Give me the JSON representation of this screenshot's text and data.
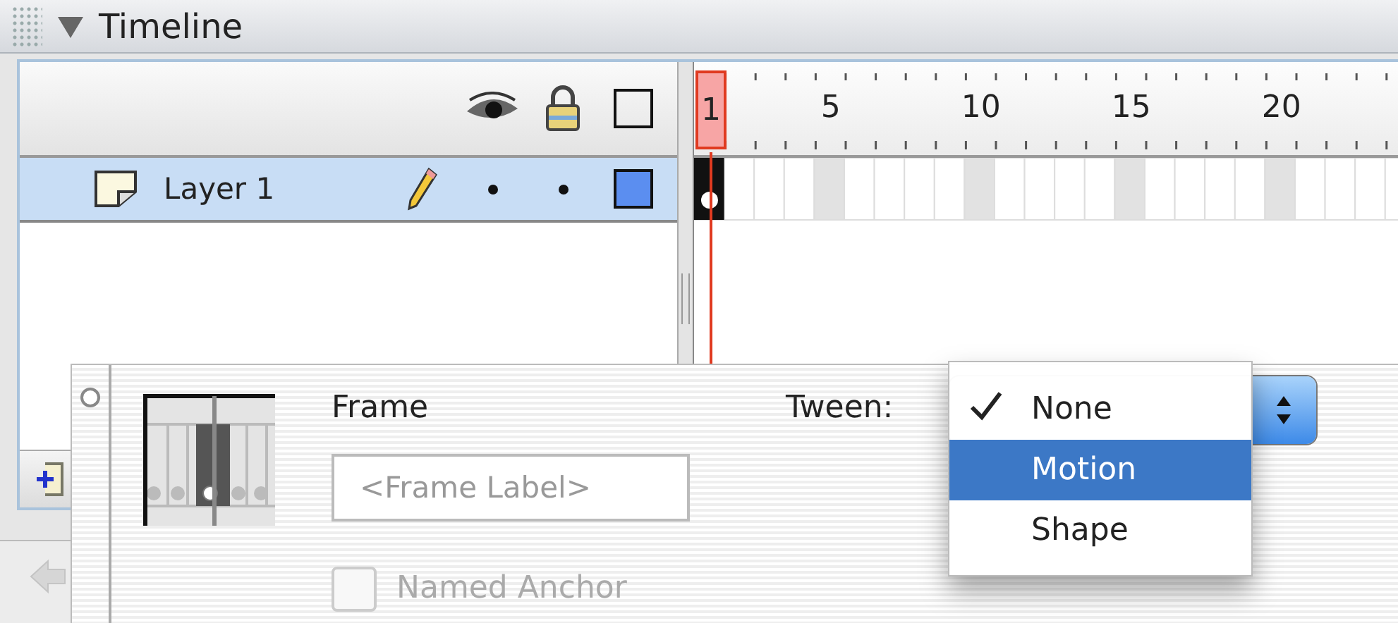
{
  "panel": {
    "title": "Timeline",
    "expanded": true
  },
  "layers": [
    {
      "name": "Layer 1",
      "selected": true,
      "editing": true,
      "visible": true,
      "locked": false,
      "color": "#5b8ef0"
    }
  ],
  "playhead": {
    "label": "1"
  },
  "ruler_labels": [
    "5",
    "10",
    "15",
    "20"
  ],
  "properties": {
    "heading": "Frame",
    "label_field": {
      "placeholder": "<Frame Label>"
    },
    "named_anchor": {
      "label": "Named Anchor",
      "checked": false,
      "disabled": true
    },
    "tween": {
      "label": "Tween:",
      "options": [
        {
          "label": "None",
          "checked": true,
          "selected": false
        },
        {
          "label": "Motion",
          "checked": false,
          "selected": true
        },
        {
          "label": "Shape",
          "checked": false,
          "selected": false
        }
      ]
    }
  }
}
